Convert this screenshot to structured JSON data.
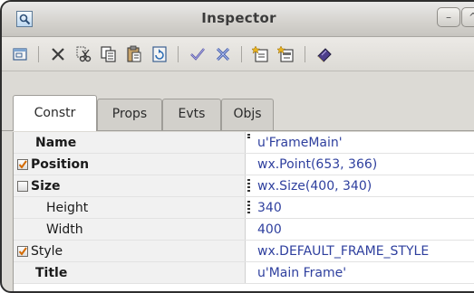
{
  "window": {
    "title": "Inspector",
    "minimize_glyph": "–",
    "maximize_glyph": "^"
  },
  "toolbar": {
    "items": [
      {
        "name": "new-object-icon"
      },
      {
        "name": "delete-icon"
      },
      {
        "name": "cut-icon"
      },
      {
        "name": "copy-icon"
      },
      {
        "name": "paste-icon"
      },
      {
        "name": "refresh-icon"
      },
      {
        "name": "apply-check-icon"
      },
      {
        "name": "cancel-icon"
      },
      {
        "name": "new-item-icon"
      },
      {
        "name": "new-item-2-icon"
      },
      {
        "name": "book-icon"
      }
    ]
  },
  "tabs": [
    {
      "label": "Constr",
      "active": true
    },
    {
      "label": "Props",
      "active": false
    },
    {
      "label": "Evts",
      "active": false
    },
    {
      "label": "Objs",
      "active": false
    }
  ],
  "properties": [
    {
      "name": "Name",
      "value": "u'FrameMain'",
      "bold": true,
      "checkbox": "none",
      "indent": false
    },
    {
      "name": "Position",
      "value": "wx.Point(653, 366)",
      "bold": true,
      "checkbox": "checked",
      "indent": false
    },
    {
      "name": "Size",
      "value": "wx.Size(400, 340)",
      "bold": true,
      "checkbox": "unchecked",
      "indent": false
    },
    {
      "name": "Height",
      "value": "340",
      "bold": false,
      "checkbox": "none",
      "indent": true
    },
    {
      "name": "Width",
      "value": "400",
      "bold": false,
      "checkbox": "none",
      "indent": true
    },
    {
      "name": "Style",
      "value": "wx.DEFAULT_FRAME_STYLE",
      "bold": false,
      "checkbox": "checked",
      "indent": false
    },
    {
      "name": "Title",
      "value": "u'Main Frame'",
      "bold": true,
      "checkbox": "none",
      "indent": false
    }
  ],
  "colors": {
    "value_text": "#2e3f9e",
    "checkmark": "#d36a00"
  }
}
